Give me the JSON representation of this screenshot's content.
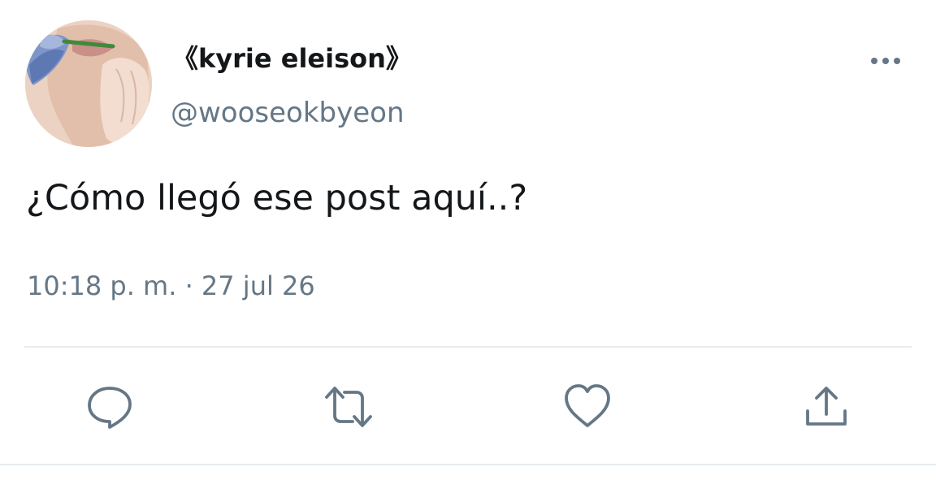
{
  "tweet": {
    "display_name": "《kyrie eleison》",
    "handle": "@wooseokbyeon",
    "text": "¿Cómo llegó ese post aquí..?",
    "timestamp": "10:18 p. m. · 27 jul 26"
  },
  "icons": {
    "more": "more-options-icon",
    "reply": "reply-icon",
    "retweet": "retweet-icon",
    "like": "heart-icon",
    "share": "share-icon"
  },
  "colors": {
    "primary_text": "#14171a",
    "secondary_text": "#657786",
    "divider": "#e6ecf0"
  }
}
